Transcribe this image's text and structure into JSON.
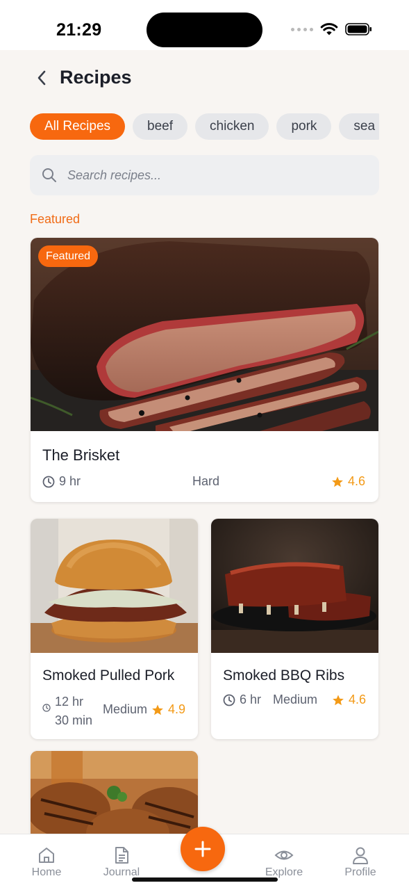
{
  "status_bar": {
    "time": "21:29"
  },
  "header": {
    "title": "Recipes"
  },
  "filters": [
    {
      "label": "All Recipes",
      "active": true
    },
    {
      "label": "beef",
      "active": false
    },
    {
      "label": "chicken",
      "active": false
    },
    {
      "label": "pork",
      "active": false
    },
    {
      "label": "sea",
      "active": false
    }
  ],
  "search": {
    "placeholder": "Search recipes..."
  },
  "section_label": "Featured",
  "featured": {
    "badge": "Featured",
    "title": "The Brisket",
    "time": "9 hr",
    "difficulty": "Hard",
    "rating": "4.6"
  },
  "recipes": [
    {
      "title": "Smoked Pulled Pork",
      "time_line1": "12 hr",
      "time_line2": "30 min",
      "difficulty": "Medium",
      "rating": "4.9"
    },
    {
      "title": "Smoked BBQ Ribs",
      "time": "6 hr",
      "difficulty": "Medium",
      "rating": "4.6"
    }
  ],
  "nav": {
    "home": "Home",
    "journal": "Journal",
    "explore": "Explore",
    "profile": "Profile"
  },
  "colors": {
    "accent": "#f7680f",
    "rating": "#f39a17",
    "background": "#f8f5f2"
  }
}
